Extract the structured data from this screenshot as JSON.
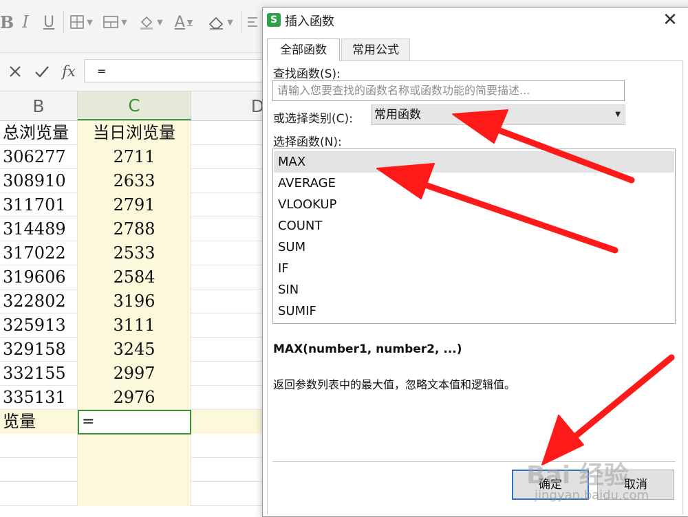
{
  "formula_bar": {
    "value": "=",
    "fx_label": "fx"
  },
  "toolbar": {
    "bold": "B",
    "italic": "I",
    "underline": "U",
    "font_color": "A"
  },
  "sheet": {
    "columns": [
      "B",
      "C",
      "D"
    ],
    "selected_column": "C",
    "header_row": {
      "b": "总浏览量",
      "c": "当日浏览量"
    },
    "rows": [
      {
        "b": "306277",
        "c": "2711"
      },
      {
        "b": "308910",
        "c": "2633"
      },
      {
        "b": "311701",
        "c": "2791"
      },
      {
        "b": "314489",
        "c": "2788"
      },
      {
        "b": "317022",
        "c": "2533"
      },
      {
        "b": "319606",
        "c": "2584"
      },
      {
        "b": "322802",
        "c": "3196"
      },
      {
        "b": "325913",
        "c": "3111"
      },
      {
        "b": "329158",
        "c": "3245"
      },
      {
        "b": "332155",
        "c": "2997"
      },
      {
        "b": "335131",
        "c": "2976"
      }
    ],
    "total_row": {
      "b": "览量",
      "c": "="
    }
  },
  "dialog": {
    "app_icon": "S",
    "title": "插入函数",
    "tabs": [
      "全部函数",
      "常用公式"
    ],
    "active_tab": "全部函数",
    "search_label": "查找函数(S):",
    "search_placeholder": "请输入您要查找的函数名称或函数功能的简要描述...",
    "category_label": "或选择类别(C):",
    "category_value": "常用函数",
    "function_label": "选择函数(N):",
    "functions": [
      "MAX",
      "AVERAGE",
      "VLOOKUP",
      "COUNT",
      "SUM",
      "IF",
      "SIN",
      "SUMIF"
    ],
    "selected_function": "MAX",
    "syntax": "MAX(number1, number2, ...)",
    "description": "返回参数列表中的最大值，忽略文本值和逻辑值。",
    "ok_label": "确定",
    "cancel_label": "取消"
  },
  "watermark": {
    "brand": "Bai 经验",
    "url": "jingyan.baidu.com"
  },
  "annotations": {
    "arrow_color": "#ff1a1a",
    "count": 3
  }
}
